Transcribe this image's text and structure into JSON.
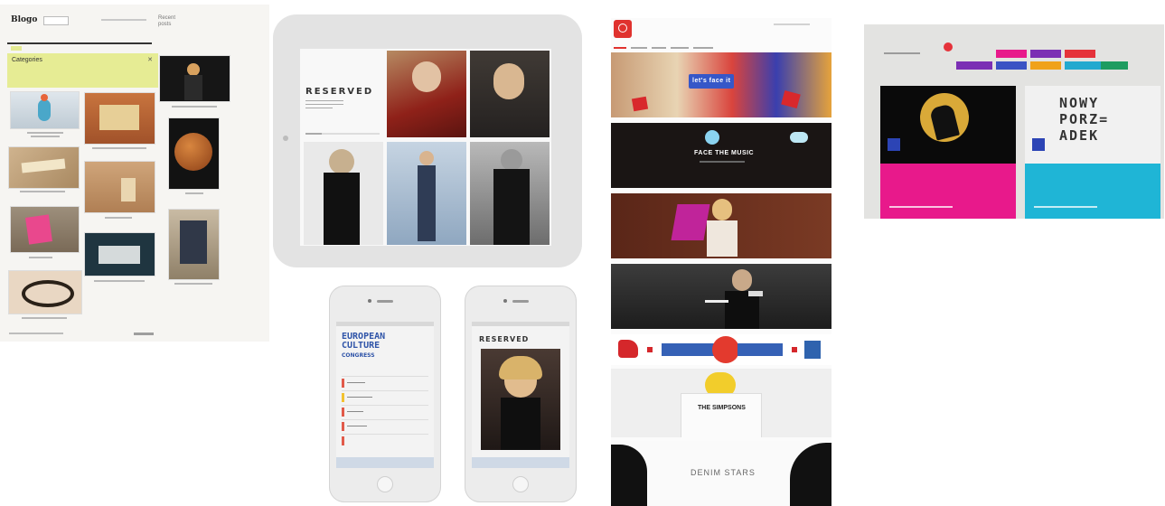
{
  "blog": {
    "logo": "Blogo",
    "side_heading": "Recent\nposts",
    "banner_title": "Categories",
    "banner_close": "✕"
  },
  "ipad": {
    "brand": "RESERVED"
  },
  "phone_left": {
    "title_line1": "EUROPEAN",
    "title_line2": "CULTURE",
    "title_line3": "CONGRESS"
  },
  "phone_right": {
    "brand": "RESERVED"
  },
  "campaign": {
    "banner_1": "let's face it",
    "banner_2": "FACE THE MUSIC",
    "banner_6": "THE SIMPSONS",
    "banner_7": "DENIM STARS"
  },
  "nowy": {
    "line1": "NOWY",
    "line2": "PORZ=",
    "line3": "ADEK"
  },
  "colors": {
    "banner_yellow": "#e6ec94",
    "reserved_red": "#e0322e",
    "magenta": "#e8198b",
    "cyan": "#1fb5d6",
    "dark": "#161616"
  }
}
